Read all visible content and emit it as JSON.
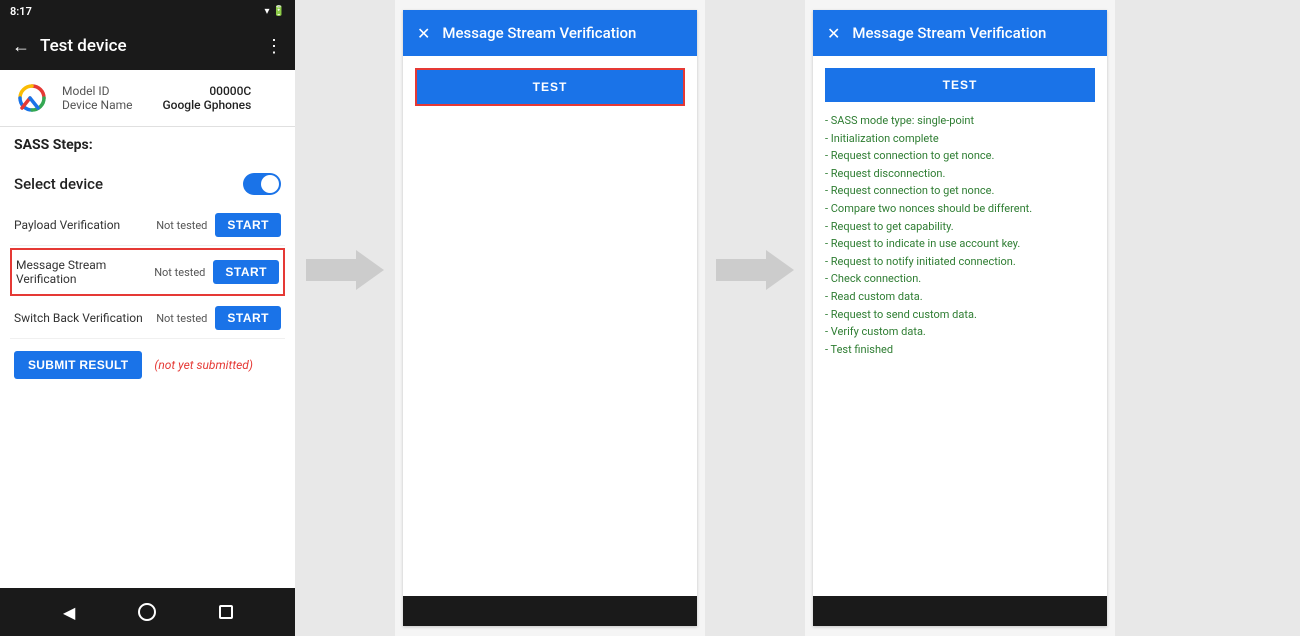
{
  "phone": {
    "status_bar": {
      "time": "8:17",
      "icons": "▲ □ ⚙ ☁ •"
    },
    "toolbar": {
      "title": "Test device",
      "back_label": "←",
      "more_label": "⋮"
    },
    "device_info": {
      "model_label": "Model ID",
      "model_value": "00000C",
      "name_label": "Device Name",
      "name_value": "Google Gphones"
    },
    "sass_title": "SASS Steps:",
    "select_device_label": "Select device",
    "steps": [
      {
        "name": "Payload Verification",
        "status": "Not tested",
        "btn": "START",
        "highlighted": false
      },
      {
        "name": "Message Stream\nVerification",
        "status": "Not tested",
        "btn": "START",
        "highlighted": true
      },
      {
        "name": "Switch Back Verification",
        "status": "Not tested",
        "btn": "START",
        "highlighted": false
      }
    ],
    "submit_btn": "SUBMIT RESULT",
    "not_submitted": "(not yet submitted)",
    "nav": {
      "back": "◀",
      "home": "",
      "recent": ""
    }
  },
  "dialog1": {
    "header": {
      "close": "✕",
      "title": "Message Stream Verification"
    },
    "test_btn": "TEST",
    "log_lines": []
  },
  "dialog2": {
    "header": {
      "close": "✕",
      "title": "Message Stream Verification"
    },
    "test_btn": "TEST",
    "log_lines": [
      "- SASS mode type: single-point",
      "- Initialization complete",
      "- Request connection to get nonce.",
      "- Request disconnection.",
      "- Request connection to get nonce.",
      "- Compare two nonces should be different.",
      "- Request to get capability.",
      "- Request to indicate in use account key.",
      "- Request to notify initiated connection.",
      "- Check connection.",
      "- Read custom data.",
      "- Request to send custom data.",
      "- Verify custom data.",
      "- Test finished"
    ]
  }
}
